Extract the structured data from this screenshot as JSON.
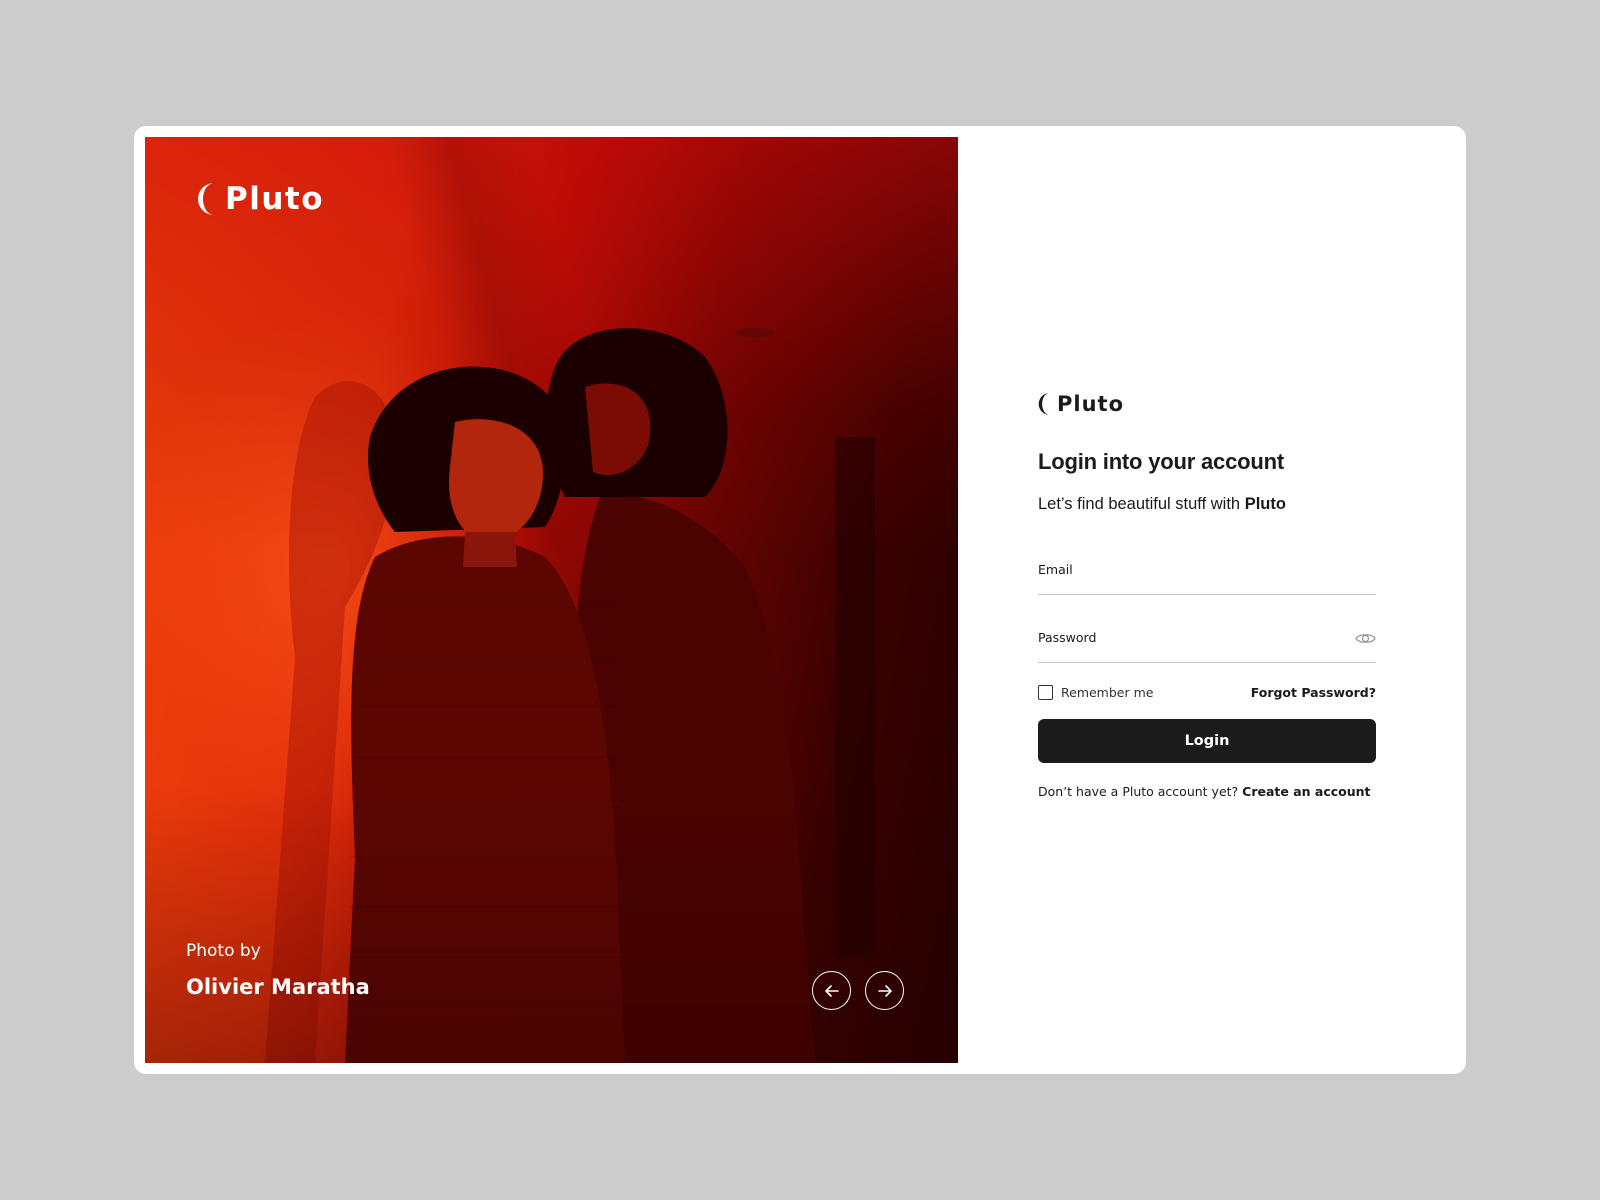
{
  "colors": {
    "page_background": "#cccccc",
    "card_background": "#ffffff",
    "photo_accent": "#e3300a",
    "button_background": "#1b1b1b",
    "button_text": "#ffffff",
    "text_primary": "#1b1b1b",
    "field_underline": "#c8c8c8"
  },
  "photo_panel": {
    "brand_name": "Pluto",
    "brand_icon": "crescent-moon-icon",
    "credit_label": "Photo by",
    "credit_name": "Olivier Maratha",
    "prev_icon": "arrow-left-icon",
    "next_icon": "arrow-right-icon"
  },
  "login_panel": {
    "brand_name": "Pluto",
    "brand_icon": "crescent-moon-icon",
    "heading": "Login into your account",
    "subtitle_text": "Let’s find beautiful stuff with ",
    "subtitle_brand": "Pluto",
    "email": {
      "label": "Email",
      "value": ""
    },
    "password": {
      "label": "Password",
      "value": "",
      "toggle_icon": "eye-icon"
    },
    "remember_label": "Remember me",
    "remember_checked": false,
    "forgot_label": "Forgot Password?",
    "submit_label": "Login",
    "signup_prompt": "Don’t have a Pluto account yet? ",
    "signup_link": "Create an account"
  }
}
